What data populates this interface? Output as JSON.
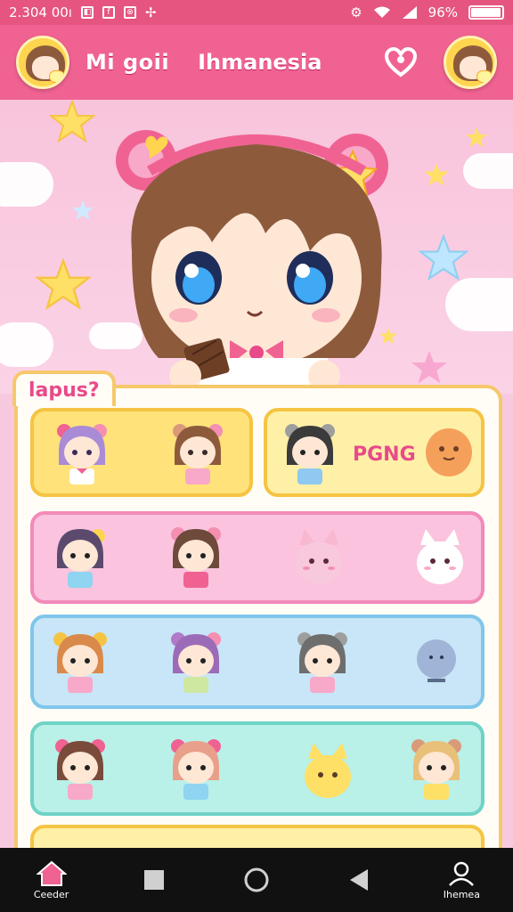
{
  "status_bar": {
    "time": "2.304 00ı",
    "glyphs": [
      "◧",
      "f",
      "⊗",
      "✢"
    ],
    "battery_text": "96%",
    "battery_level": 0.96
  },
  "app_bar": {
    "title": "Mi goii",
    "subtitle": "Ihmanesia",
    "heart_icon": "heart-outline-icon"
  },
  "panel": {
    "tab_label": "lapus?",
    "rows": [
      {
        "color": "#ffe27a",
        "border": "#f5c443",
        "label": ""
      },
      {
        "color": "#fff0a8",
        "border": "#f5c443",
        "label": "PGNG"
      },
      {
        "color": "#fbc3de",
        "border": "#f28ab8",
        "label": ""
      },
      {
        "color": "#c8e6f7",
        "border": "#7fc6ea",
        "label": ""
      },
      {
        "color": "#b9f0e8",
        "border": "#6fd3c6",
        "label": ""
      },
      {
        "color": "#fff0a8",
        "border": "#f5c443",
        "label": ""
      }
    ]
  },
  "nav": {
    "home_label": "Ceeder",
    "profile_label": "Ihemea"
  },
  "colors": {
    "primary": "#f06292",
    "status": "#e5557f",
    "panel_border": "#f6c86b",
    "accent_text": "#e84a8a"
  }
}
